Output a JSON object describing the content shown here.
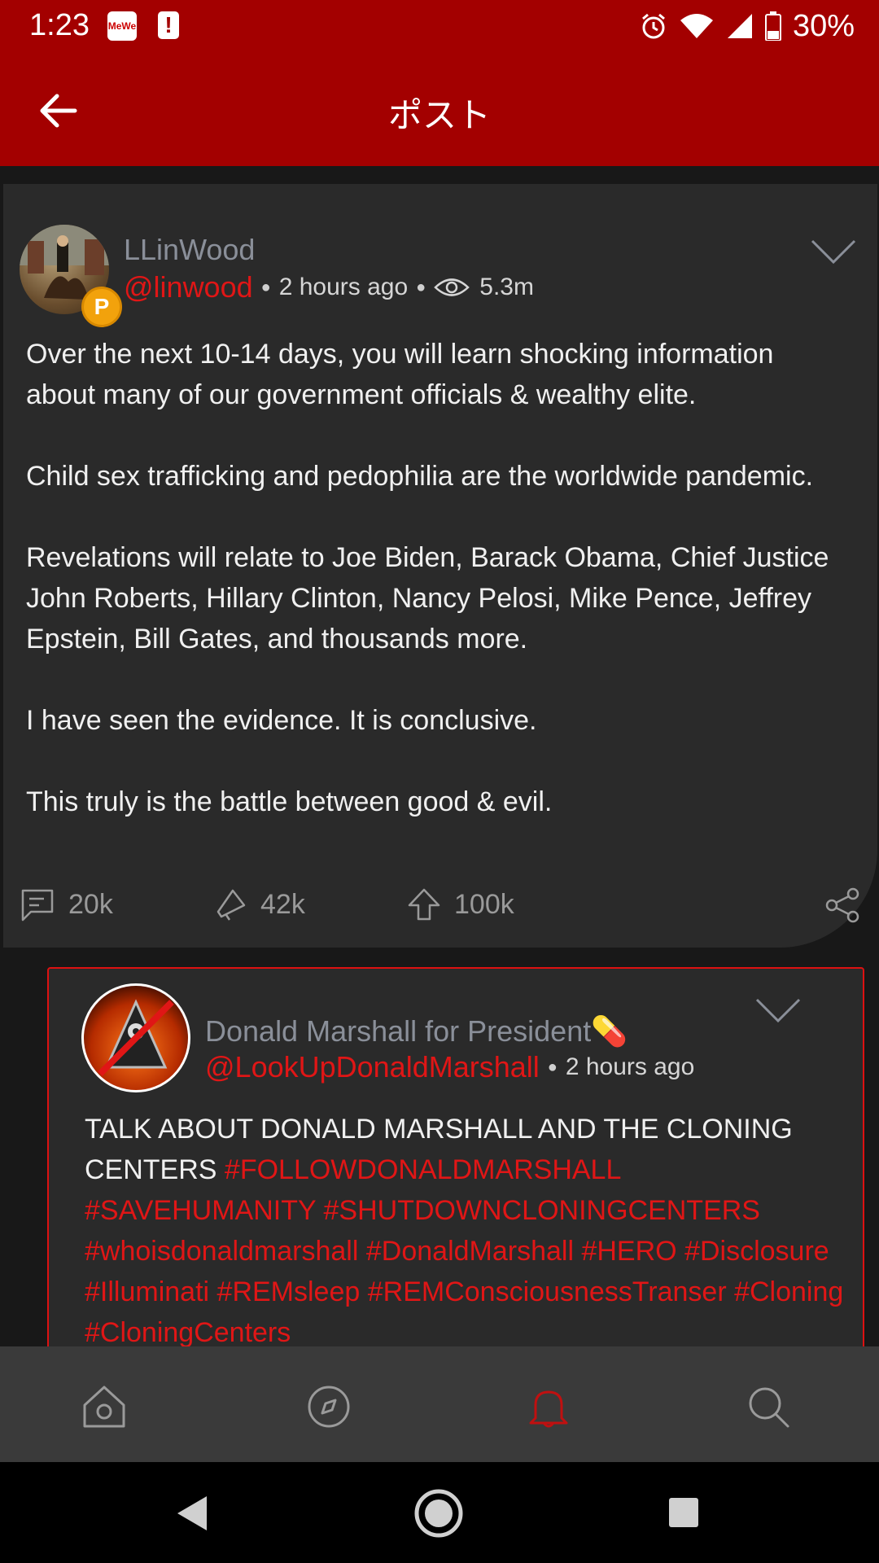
{
  "status_bar": {
    "time": "1:23",
    "mewe_label": "MeWe",
    "alert_symbol": "!",
    "battery": "30%",
    "icons": [
      "alarm-icon",
      "wifi-icon",
      "signal-icon",
      "battery-icon"
    ]
  },
  "app_bar": {
    "title": "ポスト",
    "back_icon": "arrow-left-icon"
  },
  "post": {
    "display_name": "LLinWood",
    "handle": "@linwood",
    "time": "2 hours ago",
    "views": "5.3m",
    "badge": "P",
    "paragraphs": [
      "Over the next 10-14 days, you will learn shocking information about many of our government officials & wealthy elite.",
      "Child sex trafficking and pedophilia are the worldwide pandemic.",
      "Revelations will relate to Joe Biden, Barack Obama, Chief Justice John Roberts, Hillary Clinton, Nancy Pelosi, Mike Pence, Jeffrey Epstein, Bill Gates, and thousands more.",
      "I have seen the evidence. It is conclusive.",
      "This truly is the battle between good & evil."
    ],
    "actions": {
      "comments": "20k",
      "echoes": "42k",
      "upvotes": "100k"
    }
  },
  "reply": {
    "display_name": "Donald Marshall for President💊",
    "handle": "@LookUpDonaldMarshall",
    "time": "2 hours ago",
    "text_lead": "TALK ABOUT DONALD MARSHALL AND THE CLONING CENTERS",
    "hashtags": [
      "#FOLLOWDONALDMARSHALL",
      "#SAVEHUMANITY",
      "#SHUTDOWNCLONINGCENTERS",
      "#whoisdonaldmarshall",
      "#DonaldMarshall",
      "#HERO",
      "#Disclosure",
      "#Illuminati",
      "#REMsleep",
      "#REMConsciousnessTranser",
      "#Cloning",
      "#CloningCenters"
    ]
  },
  "bottom_nav": [
    "home-icon",
    "compass-icon",
    "bell-icon",
    "search-icon"
  ],
  "system_nav": [
    "back-triangle-icon",
    "home-circle-icon",
    "recents-square-icon"
  ],
  "colors": {
    "brand_red": "#a30000",
    "accent_red": "#e01616",
    "card_bg": "#2a2a2a",
    "page_bg": "#181818",
    "nav_bg": "#3a3a3a"
  }
}
